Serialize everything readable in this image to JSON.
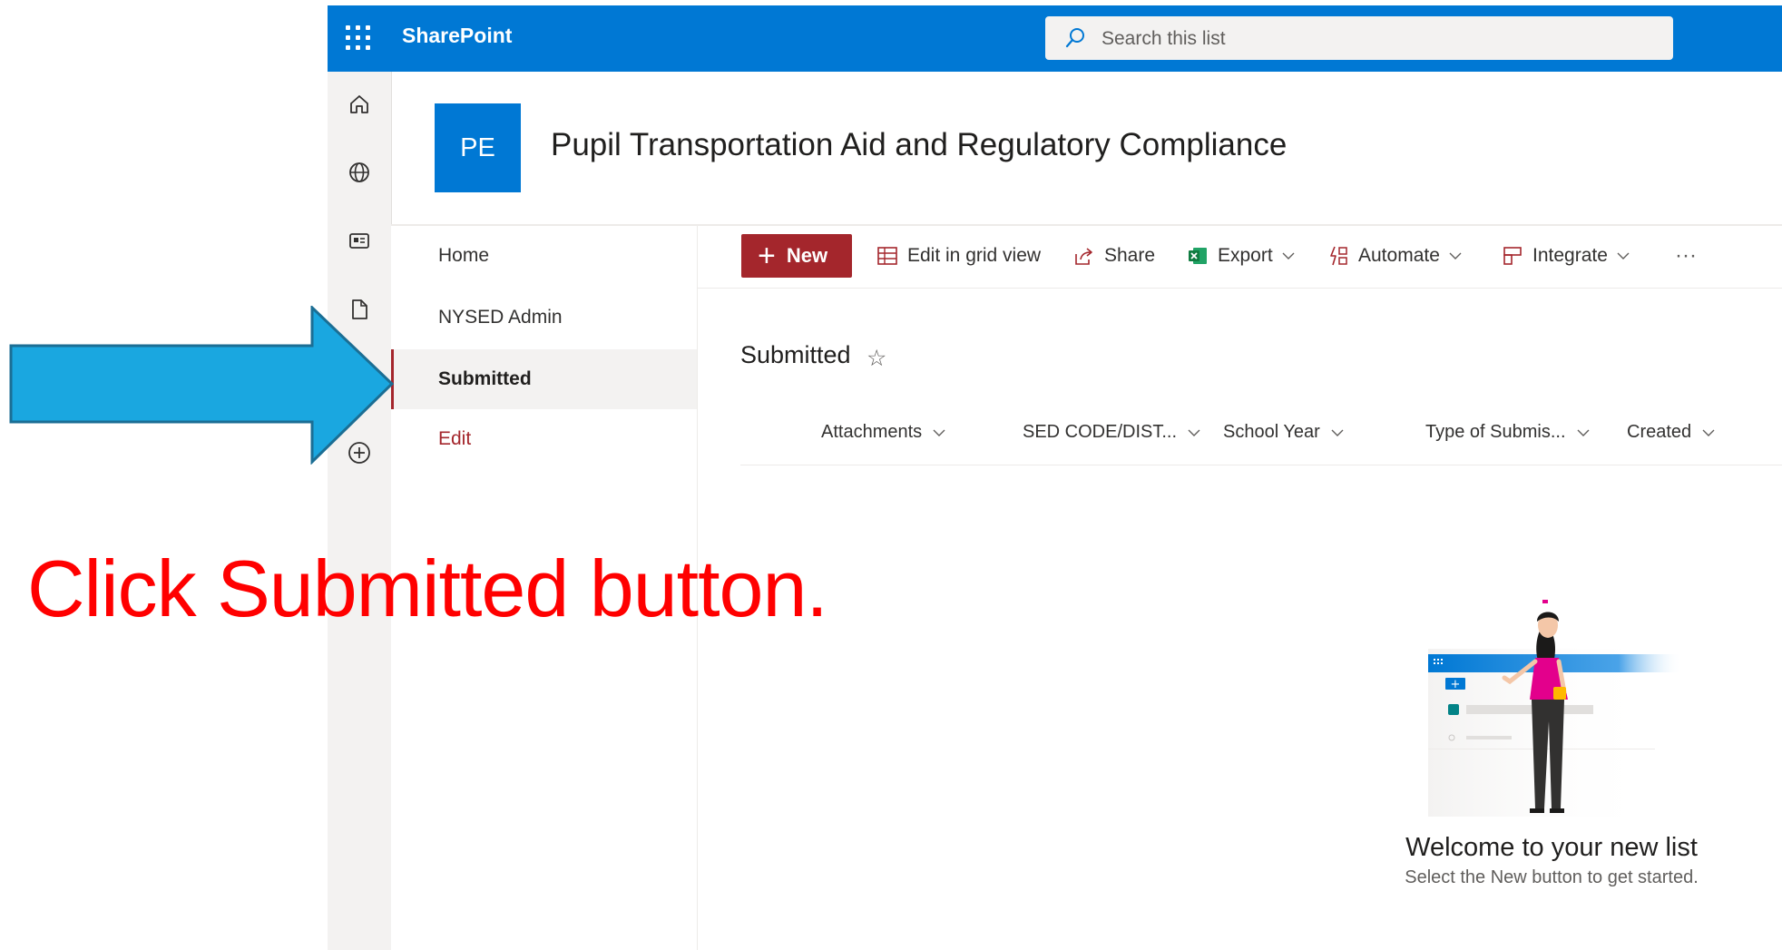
{
  "suite_bar": {
    "brand": "SharePoint",
    "search_placeholder": "Search this list",
    "color": "#0078d4"
  },
  "app_bar": {
    "icons": [
      "home-icon",
      "globe-icon",
      "news-icon",
      "document-icon",
      "add-circle-icon"
    ]
  },
  "site": {
    "logo_initials": "PE",
    "title": "Pupil Transportation Aid and Regulatory Compliance"
  },
  "left_nav": {
    "items": [
      {
        "label": "Home"
      },
      {
        "label": "NYSED Admin"
      },
      {
        "label": "Submitted",
        "selected": true
      },
      {
        "label": "Edit"
      }
    ]
  },
  "command_bar": {
    "new_label": "New",
    "edit_grid_label": "Edit in grid view",
    "share_label": "Share",
    "export_label": "Export",
    "automate_label": "Automate",
    "integrate_label": "Integrate",
    "more_label": "···"
  },
  "list_view": {
    "title": "Submitted",
    "favorite_icon": "☆",
    "columns": [
      "Attachments",
      "SED CODE/DIST...",
      "School Year",
      "Type of Submis...",
      "Created"
    ]
  },
  "empty_state": {
    "heading": "Welcome to your new list",
    "subtext": "Select the New button to get started."
  },
  "annotation": {
    "text": "Click Submitted button.",
    "text_color": "#ff0000",
    "arrow_color": "#1aa7e0"
  },
  "colors": {
    "accent_red": "#a4262c",
    "nav_selected_bg": "#f3f2f1"
  }
}
